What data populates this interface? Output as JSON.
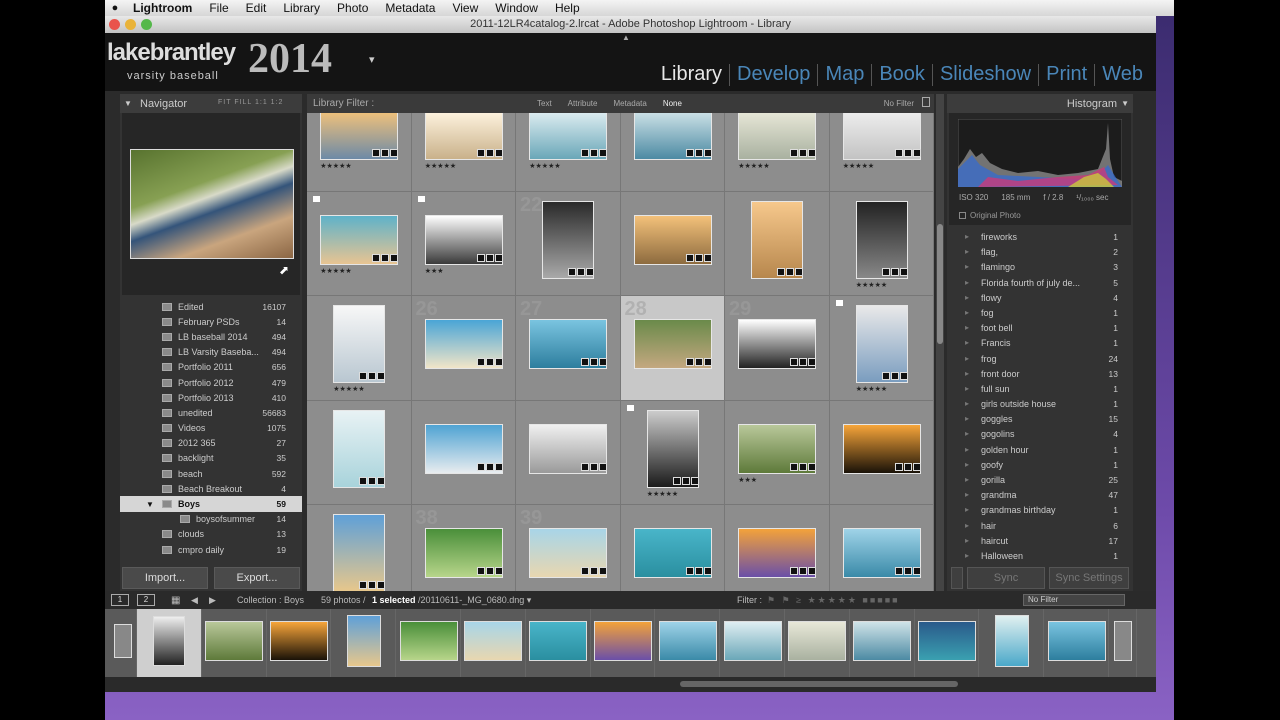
{
  "menubar": {
    "app": "Lightroom",
    "items": [
      "File",
      "Edit",
      "Library",
      "Photo",
      "Metadata",
      "View",
      "Window",
      "Help"
    ]
  },
  "window": {
    "title": "2011-12LR4catalog-2.lrcat - Adobe Photoshop Lightroom - Library"
  },
  "identity": {
    "name": "lakebrantley",
    "subtitle": "varsity baseball",
    "year": "2014"
  },
  "modules": [
    "Library",
    "Develop",
    "Map",
    "Book",
    "Slideshow",
    "Print",
    "Web"
  ],
  "navigator": {
    "title": "Navigator",
    "zoom": "FIT  FILL  1:1  1:2"
  },
  "collections": [
    {
      "name": "Edited",
      "count": "16107"
    },
    {
      "name": "February PSDs",
      "count": "14"
    },
    {
      "name": "LB baseball 2014",
      "count": "494"
    },
    {
      "name": "LB Varsity Baseba...",
      "count": "494"
    },
    {
      "name": "Portfolio 2011",
      "count": "656"
    },
    {
      "name": "Portfolio 2012",
      "count": "479"
    },
    {
      "name": "Portfolio 2013",
      "count": "410"
    },
    {
      "name": "unedited",
      "count": "56683"
    },
    {
      "name": "Videos",
      "count": "1075"
    },
    {
      "name": "2012 365",
      "count": "27"
    },
    {
      "name": "backlight",
      "count": "35"
    },
    {
      "name": "beach",
      "count": "592"
    },
    {
      "name": "Beach Breakout",
      "count": "4"
    },
    {
      "name": "Boys",
      "count": "59"
    },
    {
      "name": "boysofsummer",
      "count": "14"
    },
    {
      "name": "clouds",
      "count": "13"
    },
    {
      "name": "cmpro daily",
      "count": "19"
    }
  ],
  "left_buttons": {
    "import": "Import...",
    "export": "Export..."
  },
  "filter": {
    "label": "Library Filter :",
    "options": [
      "Text",
      "Attribute",
      "Metadata",
      "None"
    ],
    "preset": "No Filter"
  },
  "grid": {
    "numbers": [
      "",
      "",
      "",
      "",
      "",
      "",
      "",
      "",
      "22",
      "",
      "",
      "",
      "",
      "26",
      "27",
      "28",
      "29",
      "",
      "",
      "",
      "",
      "",
      "",
      "",
      "",
      "38",
      "39",
      "",
      "",
      ""
    ]
  },
  "histogram": {
    "title": "Histogram",
    "iso": "ISO 320",
    "focal": "185 mm",
    "aperture": "f / 2.8",
    "shutter": "¹/₁₀₀₀ sec",
    "original": "Original Photo"
  },
  "keywords": [
    {
      "name": "fireworks",
      "count": "1"
    },
    {
      "name": "flag,",
      "count": "2"
    },
    {
      "name": "flamingo",
      "count": "3"
    },
    {
      "name": "Florida fourth of july de...",
      "count": "5"
    },
    {
      "name": "flowy",
      "count": "4"
    },
    {
      "name": "fog",
      "count": "1"
    },
    {
      "name": "foot bell",
      "count": "1"
    },
    {
      "name": "Francis",
      "count": "1"
    },
    {
      "name": "frog",
      "count": "24"
    },
    {
      "name": "front door",
      "count": "13"
    },
    {
      "name": "full sun",
      "count": "1"
    },
    {
      "name": "girls outside house",
      "count": "1"
    },
    {
      "name": "goggles",
      "count": "15"
    },
    {
      "name": "gogolins",
      "count": "4"
    },
    {
      "name": "golden hour",
      "count": "1"
    },
    {
      "name": "goofy",
      "count": "1"
    },
    {
      "name": "gorilla",
      "count": "25"
    },
    {
      "name": "grandma",
      "count": "47"
    },
    {
      "name": "grandmas birthday",
      "count": "1"
    },
    {
      "name": "hair",
      "count": "6"
    },
    {
      "name": "haircut",
      "count": "17"
    },
    {
      "name": "Halloween",
      "count": "1"
    }
  ],
  "right_buttons": {
    "sync": "Sync",
    "sync_settings": "Sync Settings"
  },
  "filmstrip_bar": {
    "page1": "1",
    "page2": "2",
    "collection": "Collection : Boys",
    "count_prefix": "59 photos /",
    "selected": "1 selected",
    "file": "/20110611-_MG_0680.dng ▾",
    "filter_label": "Filter :",
    "filter_value": "No Filter"
  }
}
